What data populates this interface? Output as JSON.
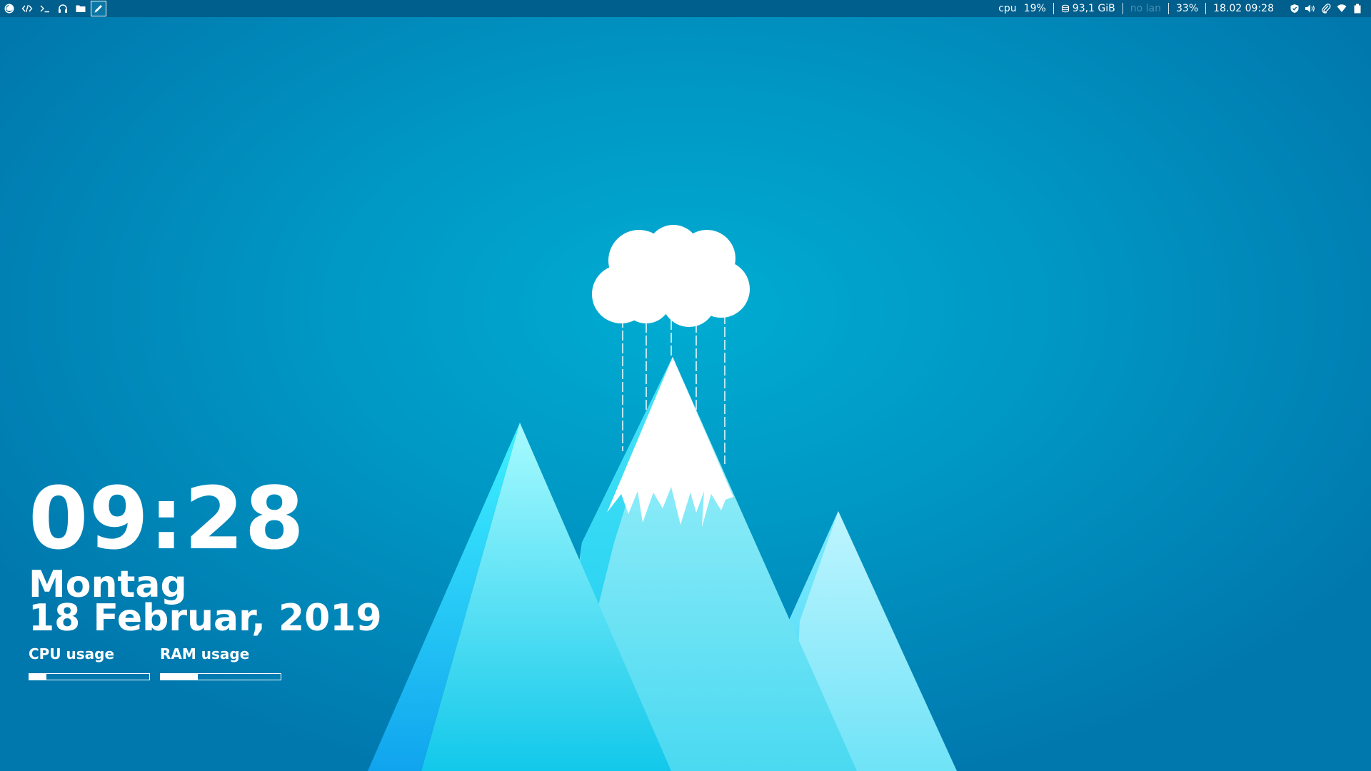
{
  "launchers": [
    {
      "name": "firefox-icon",
      "active": false
    },
    {
      "name": "code-editor-icon",
      "active": false
    },
    {
      "name": "terminal-icon",
      "active": false
    },
    {
      "name": "headphones-icon",
      "active": false
    },
    {
      "name": "folder-icon",
      "active": false
    },
    {
      "name": "pencil-icon",
      "active": true
    }
  ],
  "status": {
    "cpu_label": "cpu",
    "cpu_value": "19%",
    "disk_value": "93,1 GiB",
    "lan_status": "no lan",
    "battery_value": "33%",
    "datetime": "18.02 09:28"
  },
  "tray": [
    "shield-icon",
    "volume-icon",
    "paperclip-icon",
    "wifi-icon",
    "battery-icon"
  ],
  "widget": {
    "time": "09:28",
    "day": "Montag",
    "date": "18 Februar, 2019",
    "cpu_label": "CPU usage",
    "ram_label": "RAM usage",
    "cpu_usage": 0.14,
    "ram_usage": 0.31
  },
  "colors": {
    "bar_background": "#005f8c",
    "meter_fill": "#ffffff"
  }
}
